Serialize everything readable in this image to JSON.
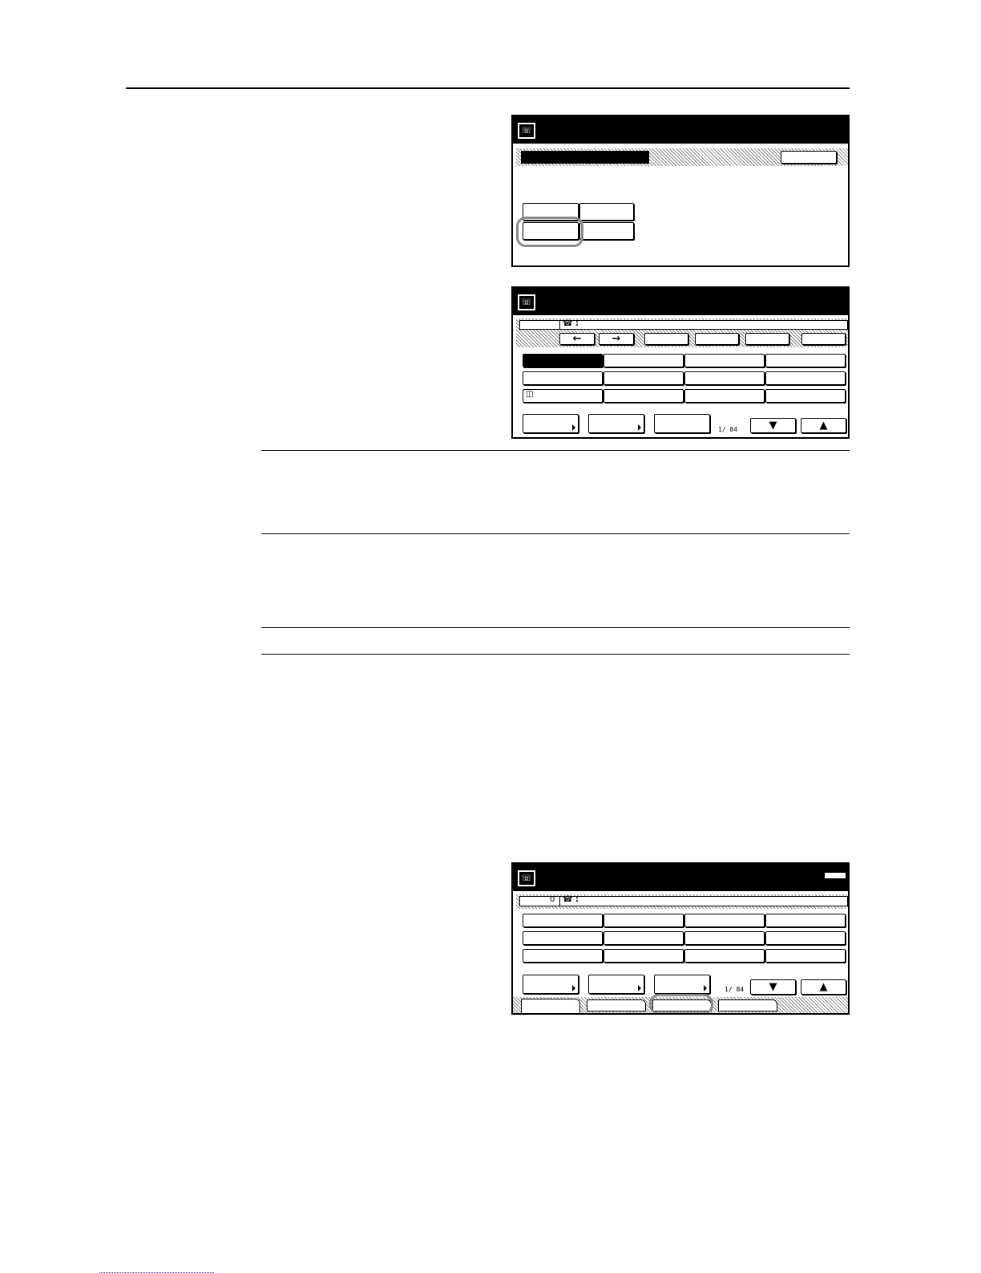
{
  "icons": {
    "fax": "fax-icon",
    "phone": "phone-icon",
    "left_arrow": "left-arrow-icon",
    "right_arrow": "right-arrow-icon",
    "down_arrow": "down-arrow-icon",
    "up_arrow": "up-arrow-icon",
    "address_book": "address-book-icon"
  },
  "panel2": {
    "phone_label": "☎ :",
    "left_arrow_label": "←",
    "right_arrow_label": "→",
    "address_book_glyph": "◫",
    "pager": "1/ 84",
    "down_label": "▼",
    "up_label": "▲"
  },
  "panel3": {
    "count": "0",
    "phone_label": "☎ :",
    "pager": "1/ 84",
    "down_label": "▼",
    "up_label": "▲"
  },
  "colors": {
    "highlight": "#8a8a8a"
  }
}
